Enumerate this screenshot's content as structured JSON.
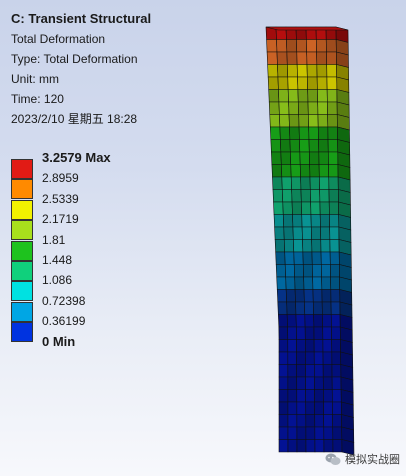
{
  "info": {
    "title": "C: Transient Structural",
    "result_name": "Total Deformation",
    "type_line": "Type: Total Deformation",
    "unit_line": "Unit: mm",
    "time_line": "Time: 120",
    "date_line": "2023/2/10 星期五 18:28"
  },
  "legend": {
    "entries": [
      {
        "label": "3.2579 Max",
        "color": "#e11b15",
        "bold": true
      },
      {
        "label": "2.8959",
        "color": "#ff8a00"
      },
      {
        "label": "2.5339",
        "color": "#f2f200"
      },
      {
        "label": "2.1719",
        "color": "#a8e01c"
      },
      {
        "label": "1.81",
        "color": "#1ec21e"
      },
      {
        "label": "1.448",
        "color": "#10d07c"
      },
      {
        "label": "1.086",
        "color": "#00e1e1"
      },
      {
        "label": "0.72398",
        "color": "#00a6e4"
      },
      {
        "label": "0.36199",
        "color": "#0033e0"
      },
      {
        "label": "0 Min",
        "color": "#0000c8",
        "bold": true
      }
    ]
  },
  "watermark": {
    "text": "模拟实战圈",
    "icon": "wechat-icon"
  }
}
